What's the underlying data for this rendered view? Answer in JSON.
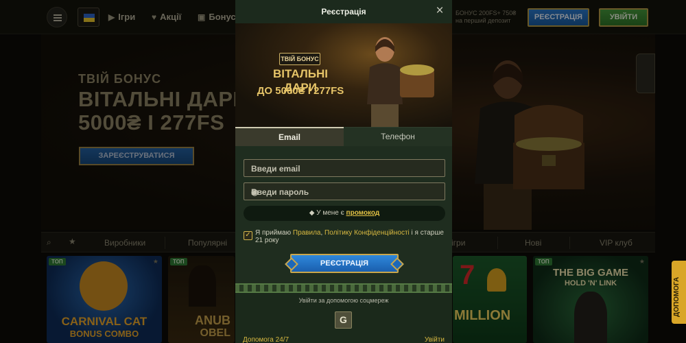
{
  "header": {
    "nav": [
      {
        "label": "Ігри",
        "icon": "play-icon"
      },
      {
        "label": "Акції",
        "icon": "heart-icon"
      },
      {
        "label": "Бонуси",
        "icon": "gift-icon"
      }
    ],
    "bonus_line1": "БОНУС 200FS+ 750₴",
    "bonus_line2": "на перший депозит",
    "register_label": "РЕЄСТРАЦІЯ",
    "login_label": "УВІЙТИ"
  },
  "hero": {
    "line1": "ТВІЙ БОНУС",
    "line2": "ВІТАЛЬНІ ДАРИ",
    "line3": "5000₴ І 277FS",
    "cta": "ЗАРЕЄСТРУВАТИСЯ"
  },
  "categories": [
    "Виробники",
    "Популярні",
    "ігри",
    "Нові",
    "VIP клуб"
  ],
  "tiles": [
    {
      "badge": "ТОП",
      "title1": "CARNIVAL CAT",
      "title2": "BONUS COMBO"
    },
    {
      "badge": "ТОП",
      "title1": "ANUB",
      "title2": "OBEL"
    },
    {
      "badge": "",
      "title1": "MILLION",
      "title2": ""
    },
    {
      "badge": "ТОП",
      "title1": "THE BIG GAME",
      "title2": "HOLD 'N' LINK"
    }
  ],
  "help_tab": "ДОПОМОГА",
  "modal": {
    "title": "Реєстрація",
    "banner": {
      "badge": "ТВІЙ БОНУС",
      "line2": "ВІТАЛЬНІ ДАРИ",
      "line3": "ДО 5000₴ І 277FS"
    },
    "tabs": [
      "Email",
      "Телефон"
    ],
    "email_placeholder": "Введи email",
    "password_placeholder": "Введи пароль",
    "promo_prefix": "У мене є",
    "promo_link": "промокод",
    "agree_prefix": "Я приймаю",
    "rules_link": "Правила",
    "privacy_link": "Політику Конфіденційності",
    "agree_suffix": "і я старше 21 року",
    "submit_label": "РЕЄСТРАЦІЯ",
    "social_label": "Увійти за допомогою соцмереж",
    "google_label": "G",
    "footer_help": "Допомога 24/7",
    "footer_login": "Увійти"
  },
  "colors": {
    "accent_gold": "#d8b941",
    "button_blue": "#1a5fae",
    "button_green": "#2e7327",
    "modal_bg": "#1b2b1b"
  }
}
